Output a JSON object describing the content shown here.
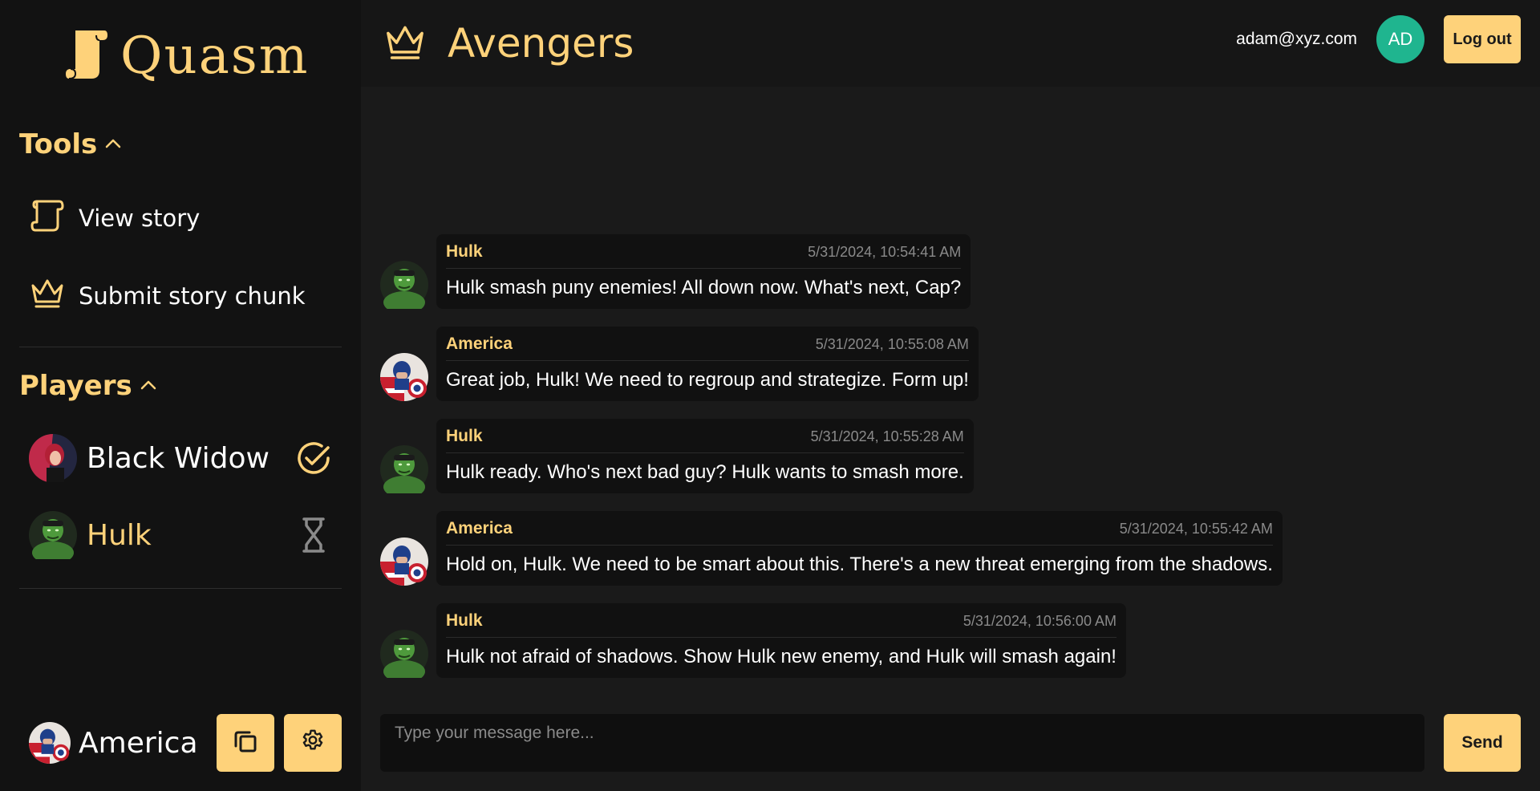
{
  "app": {
    "name": "Quasm"
  },
  "sidebar": {
    "tools_title": "Tools",
    "tools": [
      {
        "label": "View story",
        "icon": "scroll-icon"
      },
      {
        "label": "Submit story chunk",
        "icon": "crown-icon"
      }
    ],
    "players_title": "Players",
    "players": [
      {
        "name": "Black Widow",
        "status": "done",
        "status_icon": "check-circle-icon",
        "name_color": "#ffffff"
      },
      {
        "name": "Hulk",
        "status": "waiting",
        "status_icon": "hourglass-icon",
        "name_color": "#fed27a"
      }
    ],
    "current_user": {
      "name": "America"
    }
  },
  "header": {
    "room_title": "Avengers",
    "email": "adam@xyz.com",
    "avatar_initials": "AD",
    "logout_label": "Log out"
  },
  "messages": [
    {
      "author": "Hulk",
      "timestamp": "5/31/2024, 10:54:41 AM",
      "text": "Hulk smash puny enemies! All down now. What's next, Cap?",
      "avatar": "hulk"
    },
    {
      "author": "America",
      "timestamp": "5/31/2024, 10:55:08 AM",
      "text": "Great job, Hulk! We need to regroup and strategize. Form up!",
      "avatar": "america"
    },
    {
      "author": "Hulk",
      "timestamp": "5/31/2024, 10:55:28 AM",
      "text": "Hulk ready. Who's next bad guy? Hulk wants to smash more.",
      "avatar": "hulk"
    },
    {
      "author": "America",
      "timestamp": "5/31/2024, 10:55:42 AM",
      "text": "Hold on, Hulk. We need to be smart about this. There's a new threat emerging from the shadows.",
      "avatar": "america"
    },
    {
      "author": "Hulk",
      "timestamp": "5/31/2024, 10:56:00 AM",
      "text": "Hulk not afraid of shadows. Show Hulk new enemy, and Hulk will smash again!",
      "avatar": "hulk"
    }
  ],
  "composer": {
    "placeholder": "Type your message here...",
    "send_label": "Send"
  },
  "colors": {
    "accent": "#fed27a",
    "avatar_bg": "#1fb58f",
    "sidebar_bg": "#121212",
    "main_bg": "#1a1a1a"
  }
}
